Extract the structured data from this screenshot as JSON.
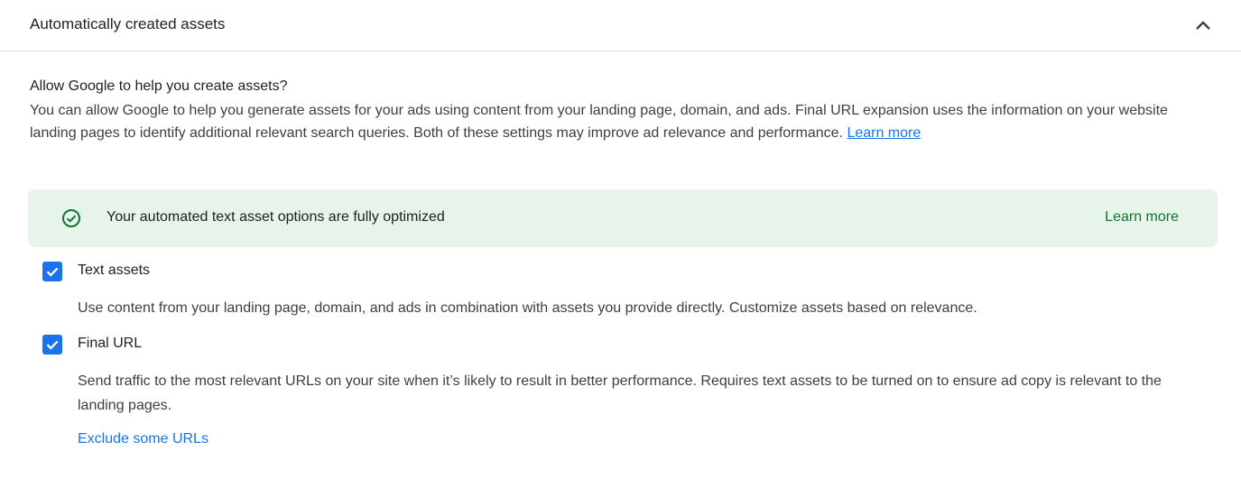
{
  "section": {
    "title": "Automatically created assets",
    "collapse_icon": "chevron-up-icon"
  },
  "intro": {
    "title": "Allow Google to help you create assets?",
    "description": "You can allow Google to help you generate assets for your ads using content from your landing page, domain, and ads. Final URL expansion uses the information on your website landing pages to identify additional relevant search queries. Both of these settings may improve ad relevance and performance.",
    "learn_more": "Learn more"
  },
  "banner": {
    "icon": "check-circle-icon",
    "message": "Your automated text asset options are fully optimized",
    "learn_more": "Learn more",
    "color": "#e6f4ea"
  },
  "options": [
    {
      "label": "Text assets",
      "checked": true,
      "description": "Use content from your landing page, domain, and ads in combination with assets you provide directly. Customize assets based on relevance."
    },
    {
      "label": "Final URL",
      "checked": true,
      "description": "Send traffic to the most relevant URLs on your site when it’s likely to result in better performance. Requires text assets to be turned on to ensure ad copy is relevant to the landing pages."
    }
  ],
  "exclude_link": "Exclude some URLs",
  "colors": {
    "accent": "#1a73e8",
    "success": "#137333"
  }
}
